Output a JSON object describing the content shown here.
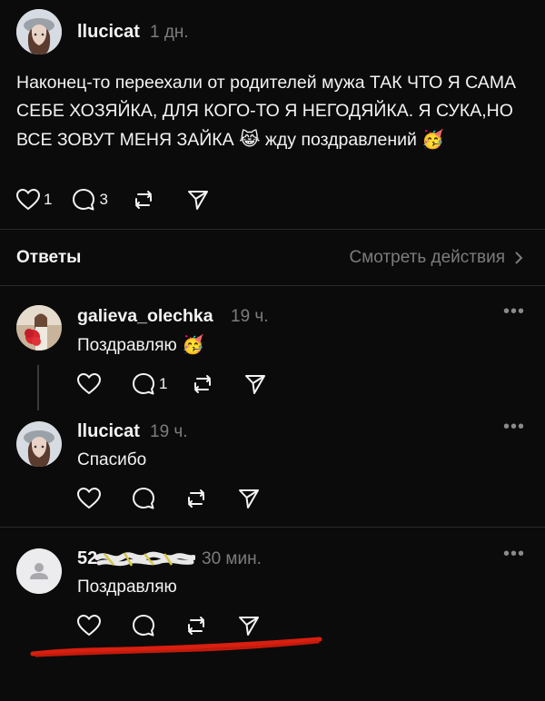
{
  "post": {
    "username": "llucicat",
    "time": "1 дн.",
    "text": "Наконец-то переехали от родителей мужа ТАК ЧТО Я САМА СЕБЕ ХОЗЯЙКА, ДЛЯ КОГО-ТО Я НЕГОДЯЙКА. Я СУКА,НО ВСЕ ЗОВУТ МЕНЯ ЗАЙКА",
    "text_emoji_1": "😹",
    "text_tail": " жду поздравлений",
    "text_emoji_2": "🥳",
    "likes": "1",
    "replies": "3"
  },
  "replies_header": {
    "title": "Ответы",
    "view_activity": "Смотреть действия"
  },
  "comments": [
    {
      "username": "galieva_olechka",
      "time": "19 ч.",
      "text": "Поздравляю",
      "emoji": "🥳",
      "reply_count": "1"
    },
    {
      "username": "llucicat",
      "time": "19 ч.",
      "text": "Спасибо"
    },
    {
      "username": "52",
      "time": "30 мин.",
      "text": "Поздравляю"
    }
  ],
  "colors": {
    "background": "#0b0b0b",
    "muted": "#7c7c7c",
    "annotation": "#d81f10"
  }
}
